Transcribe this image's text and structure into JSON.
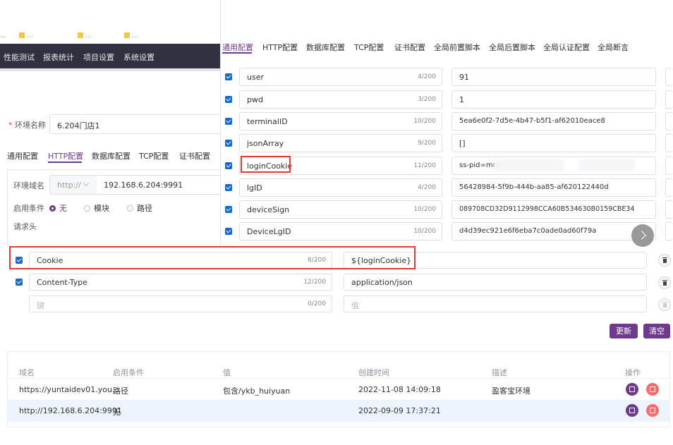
{
  "bookmarks": [
    "…",
    "…",
    "…",
    "…"
  ],
  "topnav": [
    "性能测试",
    "报表统计",
    "项目设置",
    "系统设置"
  ],
  "env": {
    "label": "环境名称",
    "value": "6.204门店1"
  },
  "tabs": [
    "通用配置",
    "HTTP配置",
    "数据库配置",
    "TCP配置",
    "证书配置"
  ],
  "http": {
    "domain_label": "环境域名",
    "protocol": "http://",
    "host": "192.168.6.204:9991",
    "condition_label": "启用条件",
    "conditions": [
      "无",
      "模块",
      "路径"
    ],
    "headers_label": "请求头"
  },
  "headers": [
    {
      "key": "Cookie",
      "count": "6/200",
      "value": "${loginCookie}"
    },
    {
      "key": "Content-Type",
      "count": "12/200",
      "value": "application/json"
    },
    {
      "key": "键",
      "count": "0/200",
      "value": "值"
    }
  ],
  "buttons": {
    "update": "更新",
    "clear": "清空"
  },
  "table": {
    "headers": [
      "域名",
      "启用条件",
      "值",
      "创建时间",
      "描述",
      "操作"
    ],
    "rows": [
      {
        "domain": "https://yuntaidev01.you…",
        "condition": "路径",
        "value": "包含/ykb_huiyuan",
        "created": "2022-11-08 14:09:18",
        "desc": "盈客宝环境"
      },
      {
        "domain": "http://192.168.6.204:9991",
        "condition": "无",
        "value": "",
        "created": "2022-09-09 17:37:21",
        "desc": ""
      }
    ]
  },
  "overlay": {
    "tabs": [
      "通用配置",
      "HTTP配置",
      "数据库配置",
      "TCP配置",
      "证书配置",
      "全局前置脚本",
      "全局后置脚本",
      "全局认证配置",
      "全局断言"
    ],
    "vars": [
      {
        "name": "user",
        "count": "4/200",
        "value": "91"
      },
      {
        "name": "pwd",
        "count": "3/200",
        "value": "1"
      },
      {
        "name": "terminalID",
        "count": "10/200",
        "value": "5ea6e0f2-7d5e-4b47-b5f1-af62010eace8"
      },
      {
        "name": "jsonArray",
        "count": "9/200",
        "value": "[]"
      },
      {
        "name": "loginCookie",
        "count": "11/200",
        "value": "ss-pid=mrQ"
      },
      {
        "name": "lgID",
        "count": "4/200",
        "value": "56428984-5f9b-444b-aa85-af620122440d"
      },
      {
        "name": "deviceSign",
        "count": "10/200",
        "value": "089708CD32D9112998CCA60B534630B0159CBE34"
      },
      {
        "name": "DeviceLgID",
        "count": "10/200",
        "value": "d4d39ec921e6f6eba7c0ade0ad60f79a"
      }
    ]
  },
  "colors": {
    "accent": "#6e3a8e",
    "danger": "#f56c6c",
    "highlight": "#e0393a",
    "checkbox": "#1769c9",
    "nav": "#2f3140"
  }
}
